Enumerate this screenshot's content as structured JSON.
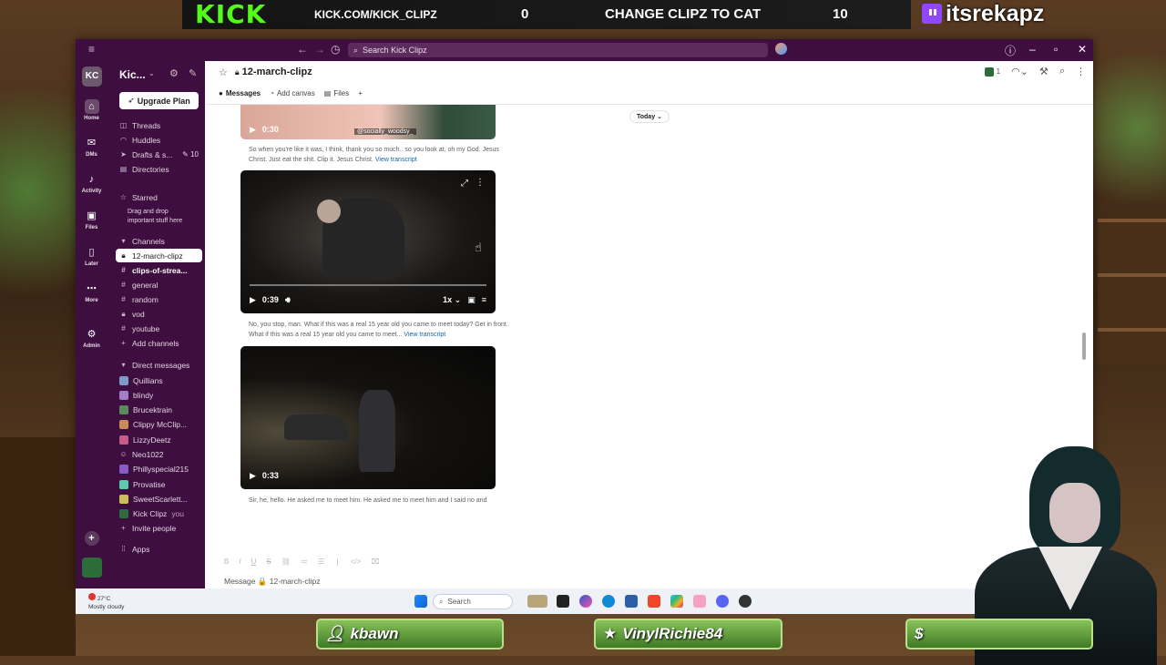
{
  "overlay": {
    "kick_logo": "KICK",
    "kick_url": "KICK.COM/KICK_CLIPZ",
    "score_left": "0",
    "vote_text": "CHANGE CLIPZ TO CAT",
    "score_right": "10",
    "twitch_handle": "itsrekapz",
    "name_plates": [
      "kbawn",
      "VinylRichie84",
      "$"
    ]
  },
  "titlebar": {
    "search_placeholder": "Search Kick Clipz"
  },
  "rail": {
    "workspace_initials": "KC",
    "items": [
      "Home",
      "DMs",
      "Activity",
      "Files",
      "Later",
      "More",
      "Admin"
    ]
  },
  "sidebar": {
    "workspace_name": "Kic...",
    "upgrade_label": "Upgrade Plan",
    "nav": [
      {
        "label": "Threads"
      },
      {
        "label": "Huddles"
      },
      {
        "label": "Drafts & s...",
        "count": "10"
      },
      {
        "label": "Directories"
      }
    ],
    "starred_header": "Starred",
    "starred_hint": "Drag and drop important stuff here",
    "channels_header": "Channels",
    "channels": [
      "12-march-clipz",
      "clips-of-strea...",
      "general",
      "random",
      "vod",
      "youtube"
    ],
    "add_channels": "Add channels",
    "dm_header": "Direct messages",
    "dms": [
      "Quillians",
      "blindy",
      "Brucektrain",
      "Clippy McClip...",
      "LizzyDeetz",
      "Neo1022",
      "Phillyspecial215",
      "Provatise",
      "SweetScarlett...",
      "Kick Clipz"
    ],
    "dm_you_tag": "you",
    "invite": "Invite people",
    "apps": "Apps"
  },
  "channel": {
    "name": "12-march-clipz",
    "tabs": [
      "Messages",
      "Add canvas",
      "Files"
    ],
    "member_count": "1",
    "date_pill": "Today"
  },
  "messages": [
    {
      "duration": "0:30",
      "overlay_text": "@socially_woodsy_",
      "caption": "So when you're like it was, I think, thank you so much.. so you look at, oh my God. Jesus Christ. Just eat the shit. Clip it. Jesus Christ.",
      "link": "View transcript"
    },
    {
      "duration": "0:39",
      "speed": "1x",
      "caption": "No, you stop, man. What if this was a real 15 year old you came to meet today? Get in front. What if this was a real 15 year old you came to meet...",
      "link": "View transcript"
    },
    {
      "duration": "0:33",
      "caption": "Sir, he, hello. He asked me to meet him. He asked me to meet him and I said no and"
    }
  ],
  "composer": {
    "placeholder": "Message 🔒 12-march-clipz"
  },
  "taskbar": {
    "temp": "27°C",
    "weather": "Mostly cloudy",
    "search": "Search"
  },
  "colors": {
    "slack_aubergine": "#3f0e40",
    "kick_green": "#53fc18",
    "link_blue": "#1264a3"
  }
}
